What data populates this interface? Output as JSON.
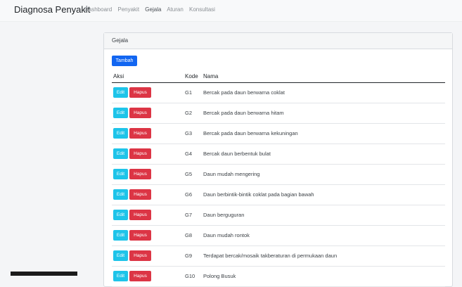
{
  "navbar": {
    "brand": "Diagnosa Penyakit",
    "links": [
      "Dashboard",
      "Penyakit",
      "Gejala",
      "Aturan",
      "Konsultasi"
    ]
  },
  "card": {
    "title": "Gejala",
    "add_label": "Tambah",
    "headers": {
      "aksi": "Aksi",
      "kode": "Kode",
      "nama": "Nama"
    },
    "edit_label": "Edit",
    "delete_label": "Hapus",
    "rows": [
      {
        "kode": "G1",
        "nama": "Bercak pada daun berwarna coklat"
      },
      {
        "kode": "G2",
        "nama": "Bercak pada daun berwarna hitam"
      },
      {
        "kode": "G3",
        "nama": "Bercak pada daun berwarna kekuningan"
      },
      {
        "kode": "G4",
        "nama": "Bercak daun berbentuk bulat"
      },
      {
        "kode": "G5",
        "nama": "Daun mudah mengering"
      },
      {
        "kode": "G6",
        "nama": "Daun berbintik-bintik coklat pada bagian bawah"
      },
      {
        "kode": "G7",
        "nama": "Daun berguguran"
      },
      {
        "kode": "G8",
        "nama": "Daun mudah rontok"
      },
      {
        "kode": "G9",
        "nama": "Terdapat bercak/mosaik takberaturan di permukaan daun"
      },
      {
        "kode": "G10",
        "nama": "Polong Busuk"
      }
    ]
  },
  "colors": {
    "primary": "#1266f1",
    "info": "#1ec4e9",
    "danger": "#dc3545"
  }
}
